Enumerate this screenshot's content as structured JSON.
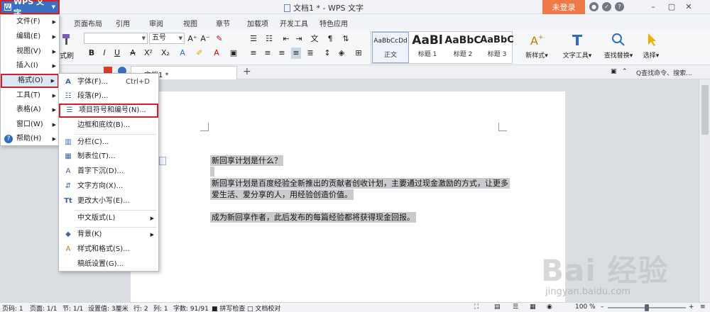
{
  "app": {
    "menu_button": "WPS 文字",
    "doc_title": "文档1 * - WPS 文字",
    "login": "未登录"
  },
  "ribbon_tabs": [
    "页面布局",
    "引用",
    "审阅",
    "视图",
    "章节",
    "加载项",
    "开发工具",
    "特色应用"
  ],
  "toolbar": {
    "format_painter": "式刷",
    "font_size": "五号",
    "styles": [
      {
        "sample": "AaBbCcDd",
        "label": "正文"
      },
      {
        "sample": "AaBl",
        "label": "标题 1"
      },
      {
        "sample": "AaBbC",
        "label": "标题 2"
      },
      {
        "sample": "AaBbC",
        "label": "标题 3"
      }
    ],
    "new_style": "新样式",
    "text_tools": "文字工具",
    "find_replace": "查找替换",
    "select": "选择"
  },
  "doc_tab": "文档1 *",
  "command_search": "Q查找命令、搜索...",
  "main_menu": [
    {
      "label": "文件(F)",
      "arrow": true
    },
    {
      "label": "编辑(E)",
      "arrow": true
    },
    {
      "label": "视图(V)",
      "arrow": true
    },
    {
      "label": "插入(I)",
      "arrow": true
    },
    {
      "label": "格式(O)",
      "arrow": true,
      "active": true
    },
    {
      "label": "工具(T)",
      "arrow": true
    },
    {
      "label": "表格(A)",
      "arrow": true
    },
    {
      "label": "窗口(W)",
      "arrow": true
    },
    {
      "label": "帮助(H)",
      "arrow": true,
      "icon": "help-icon"
    }
  ],
  "format_menu": [
    {
      "label": "字体(F)...",
      "shortcut": "Ctrl+D",
      "icon": "font-icon"
    },
    {
      "label": "段落(P)...",
      "icon": "paragraph-icon"
    },
    {
      "label": "项目符号和编号(N)...",
      "icon": "bullet-list-icon",
      "highlight": true
    },
    {
      "label": "边框和底纹(B)...",
      "icon": ""
    },
    {
      "label": "分栏(C)...",
      "icon": "columns-icon"
    },
    {
      "label": "制表位(T)...",
      "icon": "tab-stop-icon"
    },
    {
      "label": "首字下沉(D)...",
      "icon": "drop-cap-icon"
    },
    {
      "label": "文字方向(X)...",
      "icon": "text-direction-icon"
    },
    {
      "label": "更改大小写(E)...",
      "icon": "change-case-icon"
    },
    {
      "label": "中文版式(L)",
      "icon": "",
      "arrow": true
    },
    {
      "label": "背景(K)",
      "icon": "background-icon",
      "arrow": true
    },
    {
      "label": "样式和格式(S)...",
      "icon": "styles-icon"
    },
    {
      "label": "稿纸设置(G)...",
      "icon": ""
    }
  ],
  "document": {
    "lines": [
      "新回享计划是什么？",
      "新回享计划是百度经验全新推出的贡献者创收计划，主要通过现金激励的方式，让更多",
      "爱生活、爱分享的人，用经验创造价值。",
      "成为新回享作者，此后发布的每篇经验都将获得现金回报。"
    ]
  },
  "status": {
    "page_no": "页码: 1",
    "pages": "页面: 1/1",
    "section": "节: 1/1",
    "setting": "设置值: 3厘米",
    "row": "行: 2",
    "col": "列: 1",
    "words": "字数: 91/91",
    "spell": "拼写检查",
    "proof": "文档校对",
    "zoom": "100 %",
    "zoom_value": 0.5
  },
  "watermark": {
    "text": "Bai 经验",
    "url": "jingyan.baidu.com"
  },
  "colors": {
    "wps_blue": "#3b6fc1",
    "highlight_red": "#d0202a",
    "login_orange": "#ee7a4a"
  }
}
